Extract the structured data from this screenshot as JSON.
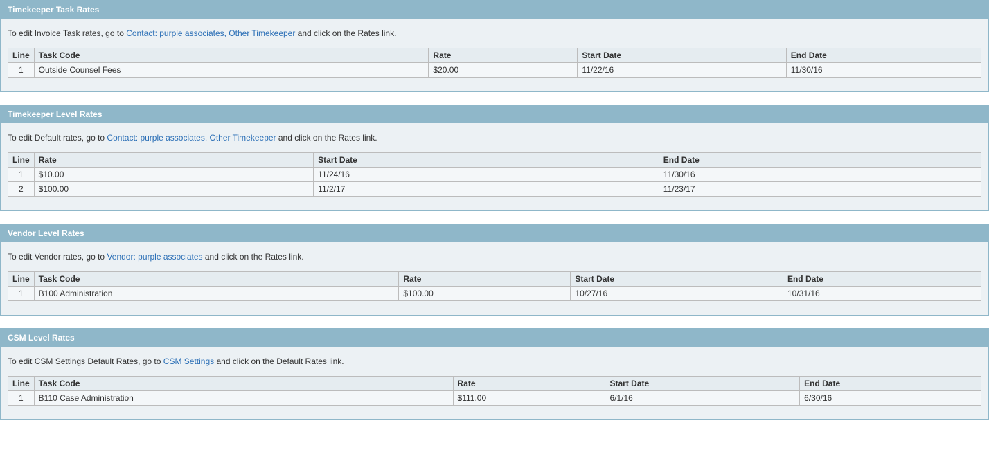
{
  "sections": [
    {
      "title": "Timekeeper Task Rates",
      "intro_prefix": "To edit Invoice Task rates, go to ",
      "intro_link": "Contact: purple associates, Other Timekeeper",
      "intro_suffix": " and click on the Rates link.",
      "columns": [
        "Line",
        "Task Code",
        "Rate",
        "Start Date",
        "End Date"
      ],
      "col_widths": [
        "34px",
        "",
        "",
        "",
        ""
      ],
      "rows": [
        {
          "line": "1",
          "cells": [
            "Outside Counsel Fees",
            "$20.00",
            "11/22/16",
            "11/30/16"
          ]
        }
      ]
    },
    {
      "title": "Timekeeper Level Rates",
      "intro_prefix": "To edit Default rates, go to ",
      "intro_link": "Contact: purple associates, Other Timekeeper",
      "intro_suffix": " and click on the Rates link.",
      "columns": [
        "Line",
        "Rate",
        "Start Date",
        "End Date"
      ],
      "col_widths": [
        "34px",
        "",
        "",
        ""
      ],
      "rows": [
        {
          "line": "1",
          "cells": [
            "$10.00",
            "11/24/16",
            "11/30/16"
          ]
        },
        {
          "line": "2",
          "cells": [
            "$100.00",
            "11/2/17",
            "11/23/17"
          ]
        }
      ]
    },
    {
      "title": "Vendor Level Rates",
      "intro_prefix": "To edit Vendor rates, go to ",
      "intro_link": "Vendor: purple associates",
      "intro_suffix": " and click on the Rates link.",
      "columns": [
        "Line",
        "Task Code",
        "Rate",
        "Start Date",
        "End Date"
      ],
      "col_widths": [
        "34px",
        "",
        "",
        "",
        ""
      ],
      "rows": [
        {
          "line": "1",
          "cells": [
            "B100 Administration",
            "$100.00",
            "10/27/16",
            "10/31/16"
          ]
        }
      ]
    },
    {
      "title": "CSM Level Rates",
      "intro_prefix": "To edit CSM Settings Default Rates, go to ",
      "intro_link": "CSM Settings",
      "intro_suffix": " and click on the Default Rates link.",
      "columns": [
        "Line",
        "Task Code",
        "Rate",
        "Start Date",
        "End Date"
      ],
      "col_widths": [
        "34px",
        "",
        "",
        "",
        ""
      ],
      "rows": [
        {
          "line": "1",
          "cells": [
            "B110 Case Administration",
            "$111.00",
            "6/1/16",
            "6/30/16"
          ]
        }
      ]
    }
  ]
}
